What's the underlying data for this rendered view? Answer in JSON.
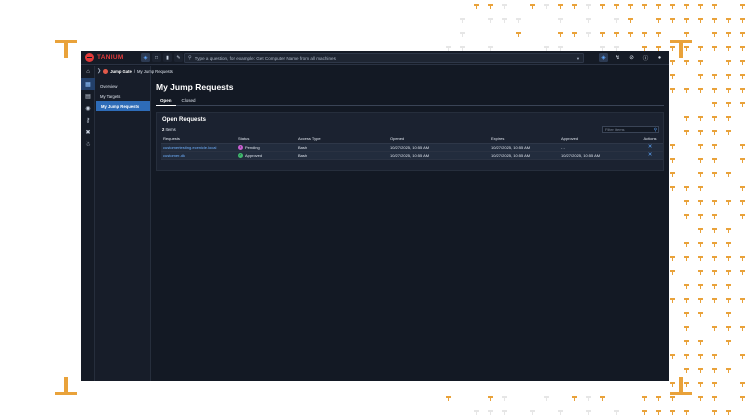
{
  "brand": {
    "logo_text": "TANIUM",
    "accent": "#e9a23a",
    "brand_red": "#e23a3a",
    "highlight": "#2e6cb8"
  },
  "topbar": {
    "search_placeholder": "Type a question, for example: Get Computer Name from all machines",
    "left_icons": [
      "shield-icon",
      "chat-icon",
      "chart-icon",
      "pencil-icon"
    ],
    "right_icons": [
      "shield-icon",
      "lightning-icon",
      "ban-icon",
      "info-icon",
      "user-icon"
    ]
  },
  "breadcrumb": {
    "module": "Jump Gate",
    "separator": "/",
    "page": "My Jump Requests"
  },
  "rail": {
    "icons": [
      "home-icon",
      "grid-icon",
      "chart-icon",
      "globe-icon",
      "key-icon",
      "tools-icon",
      "bug-icon"
    ]
  },
  "subnav": {
    "items": [
      {
        "label": "Overview",
        "active": false
      },
      {
        "label": "My Targets",
        "active": false
      },
      {
        "label": "My Jump Requests",
        "active": true
      }
    ]
  },
  "main": {
    "title": "My Jump Requests",
    "tabs": [
      {
        "label": "Open",
        "active": true
      },
      {
        "label": "Closed",
        "active": false
      }
    ],
    "section_title": "Open Requests",
    "item_count": "2",
    "item_count_suffix": "Items",
    "filter_placeholder": "Filter items",
    "columns": [
      "Requests",
      "Status",
      "Access Type",
      "Opened",
      "Expires",
      "Approved",
      "Actions"
    ],
    "rows": [
      {
        "request": "customertesting.ecenicle.local",
        "status": "Pending",
        "status_color": "#c85fd0",
        "access_type": "Bash",
        "opened": "10/27/2025, 10:55 AM",
        "expires": "10/27/2025, 10:55 AM",
        "approved": "- -"
      },
      {
        "request": "customer-dk",
        "status": "Approved",
        "status_color": "#3fb96d",
        "access_type": "Bash",
        "opened": "10/27/2025, 10:55 AM",
        "expires": "10/27/2025, 10:55 AM",
        "approved": "10/27/2025, 10:55 AM"
      }
    ]
  }
}
